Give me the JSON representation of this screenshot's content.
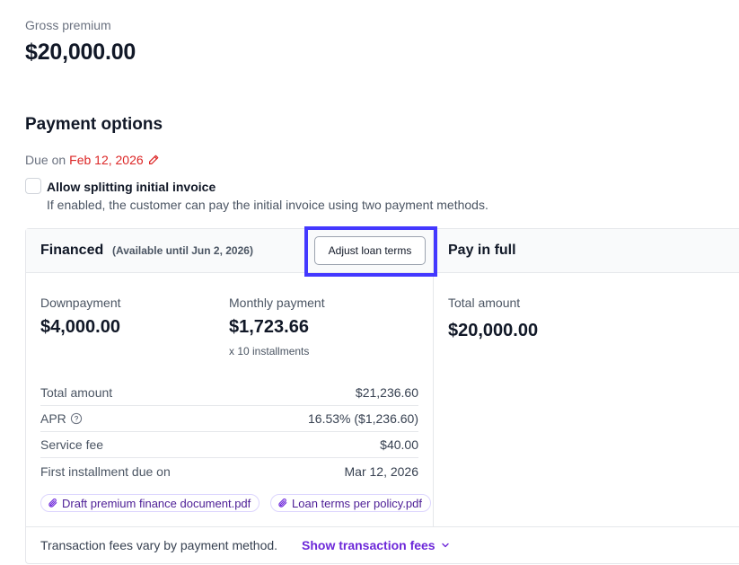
{
  "gross_premium": {
    "label": "Gross premium",
    "value": "$20,000.00"
  },
  "payment_options": {
    "title": "Payment options",
    "due_prefix": "Due on",
    "due_date": "Feb 12, 2026",
    "split": {
      "title": "Allow splitting initial invoice",
      "description": "If enabled, the customer can pay the initial invoice using two payment methods."
    }
  },
  "financed": {
    "title": "Financed",
    "availability": "(Available until Jun 2, 2026)",
    "adjust_label": "Adjust loan terms",
    "downpayment_label": "Downpayment",
    "downpayment_value": "$4,000.00",
    "monthly_label": "Monthly payment",
    "monthly_value": "$1,723.66",
    "installments": "x 10 installments",
    "rows": [
      {
        "label": "Total amount",
        "value": "$21,236.60"
      },
      {
        "label": "APR",
        "value": "16.53% ($1,236.60)"
      },
      {
        "label": "Service fee",
        "value": "$40.00"
      },
      {
        "label": "First installment due on",
        "value": "Mar 12, 2026"
      }
    ],
    "documents": [
      "Draft premium finance document.pdf",
      "Loan terms per policy.pdf"
    ]
  },
  "pay_in_full": {
    "title": "Pay in full",
    "total_label": "Total amount",
    "total_value": "$20,000.00"
  },
  "footer": {
    "note": "Transaction fees vary by payment method.",
    "link": "Show transaction fees"
  },
  "colors": {
    "accent": "#6d28d9",
    "due_date": "#dc2626",
    "highlight": "#4338ff"
  },
  "icons": [
    "pencil-icon",
    "question-circle-icon",
    "paperclip-icon",
    "chevron-down-icon"
  ]
}
